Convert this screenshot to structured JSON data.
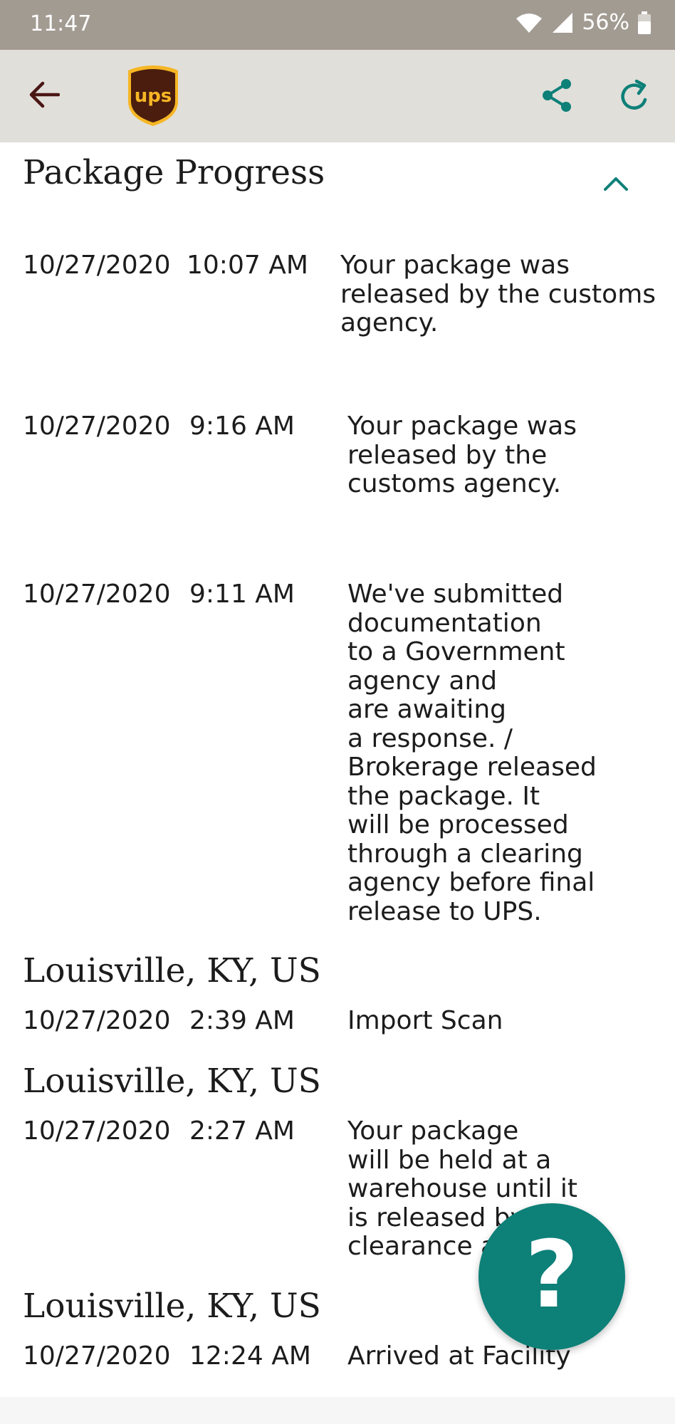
{
  "status_bar": {
    "time": "11:47",
    "battery": "56%"
  },
  "app_bar": {
    "logo_text": "ups"
  },
  "section": {
    "title": "Package Progress"
  },
  "events": [
    {
      "date": "10/27/2020",
      "time": "10:07 AM",
      "description": [
        "Your package was",
        "released by the customs",
        "agency."
      ]
    },
    {
      "date": "10/27/2020",
      "time": "9:16 AM",
      "description": [
        "Your package was",
        "released by the",
        "customs agency."
      ]
    },
    {
      "date": "10/27/2020",
      "time": "9:11 AM",
      "description": [
        "We've submitted",
        "documentation",
        "to a Government",
        "agency and",
        "are awaiting",
        "a response. /",
        "Brokerage released",
        "the package. It",
        "will be processed",
        "through a clearing",
        "agency before final",
        "release to UPS."
      ]
    },
    {
      "location": "Louisville, KY, US",
      "date": "10/27/2020",
      "time": "2:39 AM",
      "description": [
        "Import Scan"
      ]
    },
    {
      "location": "Louisville, KY, US",
      "date": "10/27/2020",
      "time": "2:27 AM",
      "description": [
        "Your package",
        "will be held at a",
        "warehouse until it",
        "is released by",
        "clearance a"
      ]
    },
    {
      "location": "Louisville, KY, US",
      "date": "10/27/2020",
      "time": "12:24 AM",
      "description": [
        "Arrived at Facility"
      ]
    }
  ],
  "help_button": {
    "label": "?"
  },
  "colors": {
    "accent": "#0d8078",
    "status_bar": "#a29b92",
    "app_bar": "#e1dfda",
    "back_arrow": "#4a1614"
  },
  "icons": [
    "wifi-icon",
    "signal-icon",
    "battery-icon",
    "back-arrow-icon",
    "ups-logo",
    "share-icon",
    "refresh-icon",
    "chevron-up-icon"
  ]
}
